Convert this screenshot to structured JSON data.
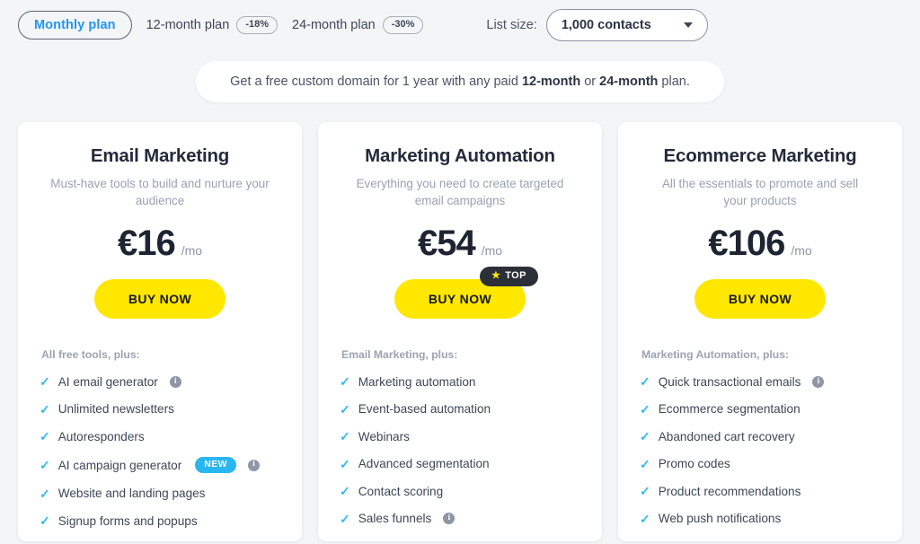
{
  "header": {
    "plan_tabs": [
      {
        "label": "Monthly plan",
        "discount": "",
        "active": true
      },
      {
        "label": "12-month plan",
        "discount": "-18%",
        "active": false
      },
      {
        "label": "24-month plan",
        "discount": "-30%",
        "active": false
      }
    ],
    "list_size_label": "List size:",
    "list_size_value": "1,000 contacts",
    "list_size_caret_icon": "chevron-down-icon"
  },
  "promo": {
    "text_part1": "Get a free custom domain for 1 year with any paid ",
    "bold1": "12-month",
    "text_part2": " or ",
    "bold2": "24-month",
    "text_part3": " plan."
  },
  "colors": {
    "accent_blue": "#2196f3",
    "check_blue": "#32b9f0",
    "badge_blue": "#2ab6f0",
    "buy_yellow": "#ffe700",
    "top_badge_dark": "#2b2f38",
    "page_bg": "#f4f5f7"
  },
  "cards": [
    {
      "title": "Email Marketing",
      "description": "Must-have tools to build and nurture your audience",
      "price": "€16",
      "period": "/mo",
      "buy_label": "BUY NOW",
      "top_badge": null,
      "features_head": "All free tools, plus:",
      "features": [
        {
          "label": "AI email generator",
          "info": true,
          "new": false
        },
        {
          "label": "Unlimited newsletters",
          "info": false,
          "new": false
        },
        {
          "label": "Autoresponders",
          "info": false,
          "new": false
        },
        {
          "label": "AI campaign generator",
          "info": true,
          "new": true,
          "new_label": "NEW"
        },
        {
          "label": "Website and landing pages",
          "info": false,
          "new": false
        },
        {
          "label": "Signup forms and popups",
          "info": false,
          "new": false
        }
      ]
    },
    {
      "title": "Marketing Automation",
      "description": "Everything you need to create targeted email campaigns",
      "price": "€54",
      "period": "/mo",
      "buy_label": "BUY NOW",
      "top_badge": "TOP",
      "features_head": "Email Marketing, plus:",
      "features": [
        {
          "label": "Marketing automation",
          "info": false,
          "new": false
        },
        {
          "label": "Event-based automation",
          "info": false,
          "new": false
        },
        {
          "label": "Webinars",
          "info": false,
          "new": false
        },
        {
          "label": "Advanced segmentation",
          "info": false,
          "new": false
        },
        {
          "label": "Contact scoring",
          "info": false,
          "new": false
        },
        {
          "label": "Sales funnels",
          "info": true,
          "new": false
        }
      ]
    },
    {
      "title": "Ecommerce Marketing",
      "description": "All the essentials to promote and sell your products",
      "price": "€106",
      "period": "/mo",
      "buy_label": "BUY NOW",
      "top_badge": null,
      "features_head": "Marketing Automation, plus:",
      "features": [
        {
          "label": "Quick transactional emails",
          "info": true,
          "new": false
        },
        {
          "label": "Ecommerce segmentation",
          "info": false,
          "new": false
        },
        {
          "label": "Abandoned cart recovery",
          "info": false,
          "new": false
        },
        {
          "label": "Promo codes",
          "info": false,
          "new": false
        },
        {
          "label": "Product recommendations",
          "info": false,
          "new": false
        },
        {
          "label": "Web push notifications",
          "info": false,
          "new": false
        }
      ]
    }
  ]
}
